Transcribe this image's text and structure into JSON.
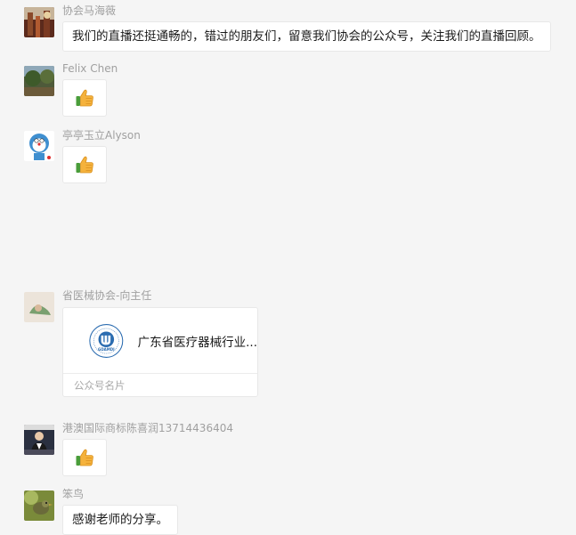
{
  "messages": [
    {
      "sender": "协会马海薇",
      "text": "我们的直播还挺通畅的，错过的朋友们，留意我们协会的公众号，关注我们的直播回顾。"
    },
    {
      "sender": "Felix Chen",
      "emoji": "thumbs-up"
    },
    {
      "sender": "亭亭玉立Alyson",
      "emoji": "thumbs-up"
    },
    {
      "sender": "省医械协会-向主任",
      "card": {
        "title": "广东省医疗器械行业...",
        "footer": "公众号名片",
        "logo_text": "GDAMDI"
      }
    },
    {
      "sender": "港澳国际商标陈喜润13714436404",
      "emoji": "thumbs-up"
    },
    {
      "sender": "笨鸟",
      "text": "感谢老师的分享。"
    }
  ],
  "colors": {
    "background": "#f5f5f5",
    "bubble": "#ffffff",
    "sender": "#a0a0a0",
    "thumb": "#f5b23c"
  }
}
